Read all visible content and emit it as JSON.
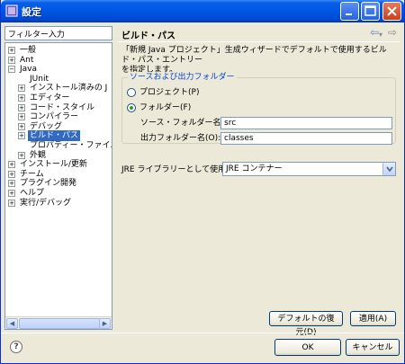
{
  "window": {
    "title": "設定"
  },
  "filter": {
    "value": "フィルター入力"
  },
  "tree": [
    {
      "label": "一般",
      "level": 0,
      "expander": "+"
    },
    {
      "label": "Ant",
      "level": 0,
      "expander": "+"
    },
    {
      "label": "Java",
      "level": 0,
      "expander": "−"
    },
    {
      "label": "JUnit",
      "level": 1,
      "expander": ""
    },
    {
      "label": "インストール済みの J",
      "level": 1,
      "expander": "+"
    },
    {
      "label": "エディター",
      "level": 1,
      "expander": "+"
    },
    {
      "label": "コード・スタイル",
      "level": 1,
      "expander": "+"
    },
    {
      "label": "コンパイラー",
      "level": 1,
      "expander": "+"
    },
    {
      "label": "デバッグ",
      "level": 1,
      "expander": "+"
    },
    {
      "label": "ビルド・パス",
      "level": 1,
      "expander": "+",
      "selected": true
    },
    {
      "label": "プロパティー・ファイル・",
      "level": 1,
      "expander": ""
    },
    {
      "label": "外観",
      "level": 1,
      "expander": "+"
    },
    {
      "label": "インストール/更新",
      "level": 0,
      "expander": "+"
    },
    {
      "label": "チーム",
      "level": 0,
      "expander": "+"
    },
    {
      "label": "プラグイン開発",
      "level": 0,
      "expander": "+"
    },
    {
      "label": "ヘルプ",
      "level": 0,
      "expander": "+"
    },
    {
      "label": "実行/デバッグ",
      "level": 0,
      "expander": "+"
    }
  ],
  "page": {
    "title": "ビルド・パス",
    "description_line1": "「新規 Java プロジェクト」生成ウィザードでデフォルトで使用するビルド・パス・エントリー",
    "description_line2": "を指定します。"
  },
  "source_group": {
    "title": "ソースおよび出力フォルダー",
    "project_label": "プロジェクト(P)",
    "folder_label": "フォルダー(F)",
    "selected": "folder",
    "source_folder_label": "ソース・フォルダー名(S):",
    "source_folder_value": "src",
    "output_folder_label": "出力フォルダー名(O):",
    "output_folder_value": "classes"
  },
  "jre": {
    "label": "JRE ライブラリーとして使用(U):",
    "value": "JRE コンテナー"
  },
  "buttons": {
    "restore_defaults": "デフォルトの復元(D)",
    "apply": "適用(A)",
    "ok": "OK",
    "cancel": "キャンセル"
  },
  "icons": {
    "back": "back-arrow-icon",
    "forward": "forward-arrow-icon",
    "help": "help-icon"
  },
  "colors": {
    "title_bar": "#0055e5",
    "selection": "#316ac5",
    "group_title": "#0046d5"
  }
}
